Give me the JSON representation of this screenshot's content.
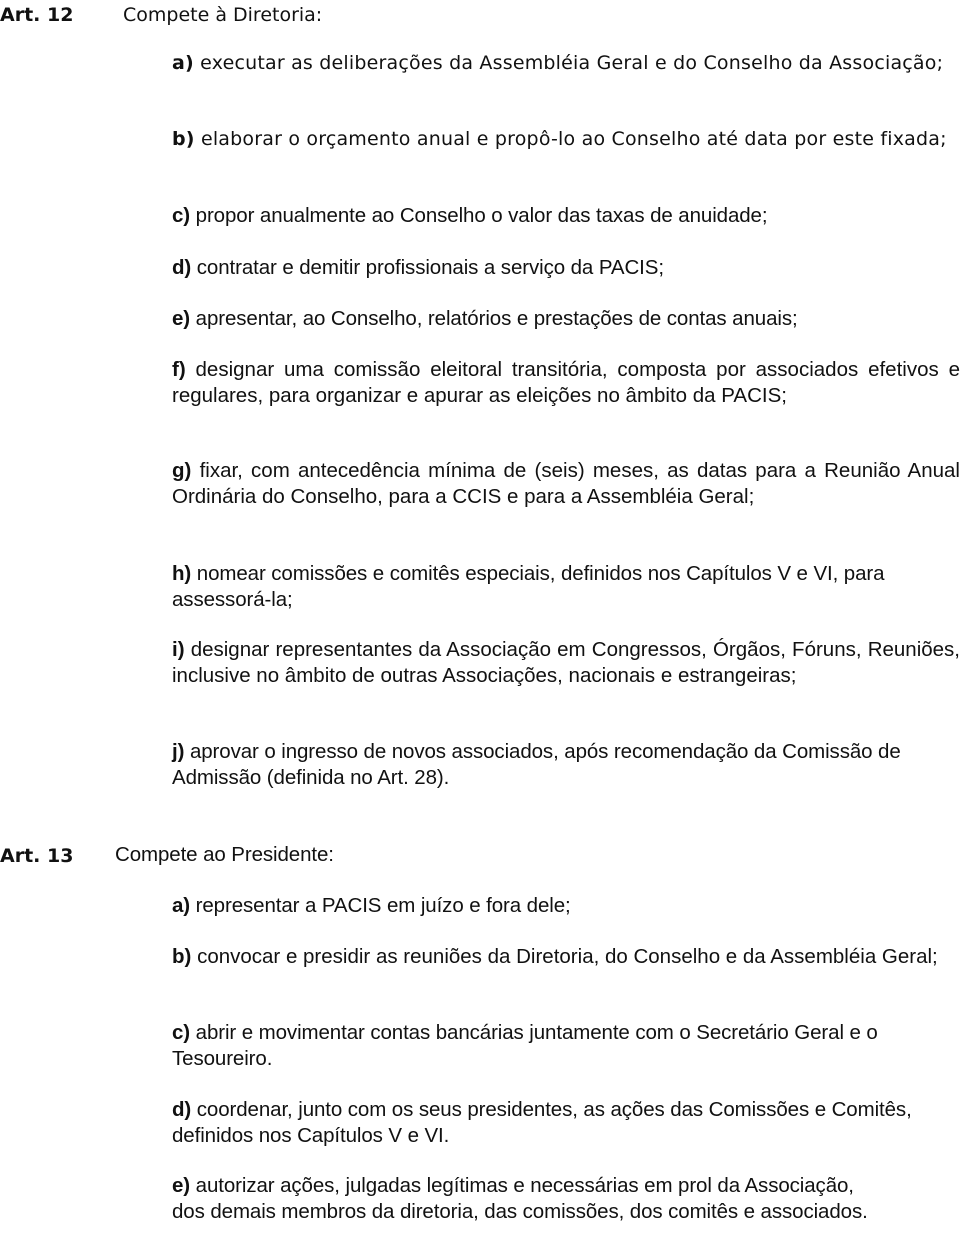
{
  "articles": [
    {
      "label": "Art. 12",
      "heading": "Compete à Diretoria:",
      "items": [
        {
          "letter": "a)",
          "text": "executar as deliberações da Assembléia Geral e do Conselho da Associação;"
        },
        {
          "letter": "b)",
          "text": "elaborar o orçamento anual e propô-lo ao Conselho até data por este fixada;"
        },
        {
          "letter": "c)",
          "text": "propor anualmente ao Conselho o valor das taxas de anuidade;"
        },
        {
          "letter": "d)",
          "text": "contratar e demitir profissionais a serviço da PACIS;"
        },
        {
          "letter": "e)",
          "text": "apresentar, ao Conselho, relatórios e prestações de contas anuais;"
        },
        {
          "letter": "f)",
          "text": "designar uma comissão eleitoral transitória, composta por associados efetivos e regulares, para organizar e apurar as eleições no âmbito da PACIS;"
        },
        {
          "letter": "g)",
          "text": "fixar, com antecedência mínima de (seis) meses, as datas para a Reunião Anual Ordinária do Conselho, para a CCIS e para a Assembléia Geral;"
        },
        {
          "letter": "h)",
          "text": "nomear comissões e comitês especiais, definidos nos Capítulos V e VI, para assessorá-la;"
        },
        {
          "letter": "i)",
          "text": "designar representantes da Associação em Congressos, Órgãos, Fóruns, Reuniões, inclusive no âmbito de outras Associações, nacionais e estrangeiras;"
        },
        {
          "letter": "j)",
          "text": "aprovar o ingresso de novos associados, após recomendação da Comissão de Admissão (definida no Art. 28)."
        }
      ]
    },
    {
      "label": "Art. 13",
      "heading": "Compete ao Presidente:",
      "items": [
        {
          "letter": "a)",
          "text": "representar a PACIS em juízo e fora dele;"
        },
        {
          "letter": "b)",
          "text": "convocar e presidir as reuniões da Diretoria, do Conselho e da Assembléia Geral;"
        },
        {
          "letter": "c)",
          "text": "abrir e movimentar contas bancárias juntamente com o Secretário Geral e o Tesoureiro."
        },
        {
          "letter": "d)",
          "text": "coordenar, junto com os seus presidentes, as ações das Comissões e Comitês, definidos nos Capítulos V e VI."
        },
        {
          "letter": "e)",
          "text": "autorizar ações, julgadas legítimas e necessárias em prol da Associação, dos demais membros da diretoria, das comissões, dos comitês e associados."
        }
      ]
    }
  ]
}
